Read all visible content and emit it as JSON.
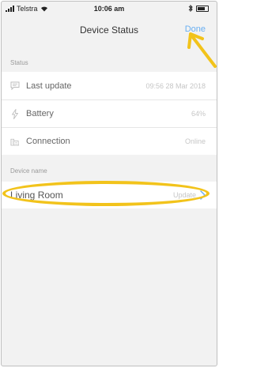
{
  "status_bar": {
    "carrier": "Telstra",
    "time": "10:06 am"
  },
  "nav": {
    "title": "Device Status",
    "done_label": "Done"
  },
  "status_section": {
    "header": "Status",
    "rows": [
      {
        "icon": "message-icon",
        "label": "Last update",
        "value": "09:56 28 Mar 2018"
      },
      {
        "icon": "bolt-icon",
        "label": "Battery",
        "value": "64%"
      },
      {
        "icon": "building-icon",
        "label": "Connection",
        "value": "Online"
      }
    ]
  },
  "device_name_section": {
    "header": "Device name",
    "name": "Living Room",
    "action_label": "Update"
  },
  "colors": {
    "accent": "#69aff2",
    "annotation": "#f2c31b",
    "background": "#f2f2f2"
  }
}
